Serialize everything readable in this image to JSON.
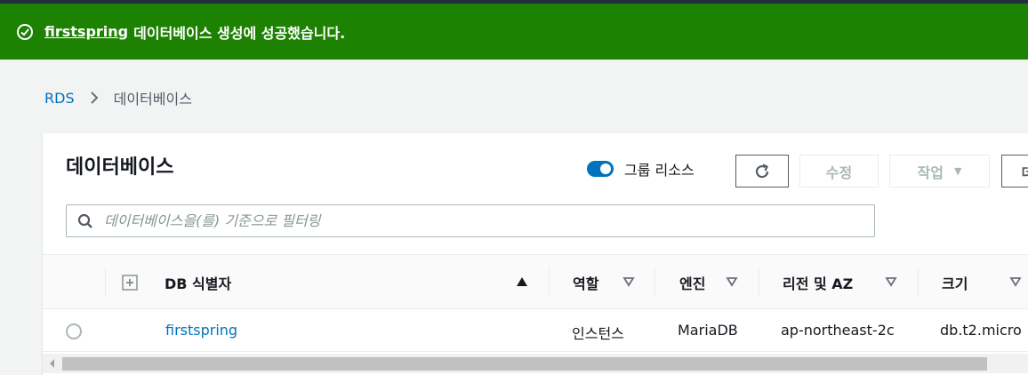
{
  "flash": {
    "db_name": "firstspring",
    "message": "데이터베이스 생성에 성공했습니다."
  },
  "breadcrumb": {
    "root": "RDS",
    "current": "데이터베이스"
  },
  "panel": {
    "title": "데이터베이스",
    "group_resources_label": "그룹 리소스",
    "group_resources_enabled": true,
    "modify_label": "수정",
    "actions_label": "작업",
    "create_label_partial": "데",
    "search_placeholder": "데이터베이스을(를) 기준으로 필터링"
  },
  "table": {
    "columns": [
      "DB 식별자",
      "역할",
      "엔진",
      "리전 및 AZ",
      "크기"
    ],
    "rows": [
      {
        "identifier": "firstspring",
        "role": "인스턴스",
        "engine": "MariaDB",
        "region_az": "ap-northeast-2c",
        "size": "db.t2.micro"
      }
    ]
  },
  "colors": {
    "success": "#1d8102",
    "link": "#0073bb",
    "topbar": "#232f3e"
  }
}
